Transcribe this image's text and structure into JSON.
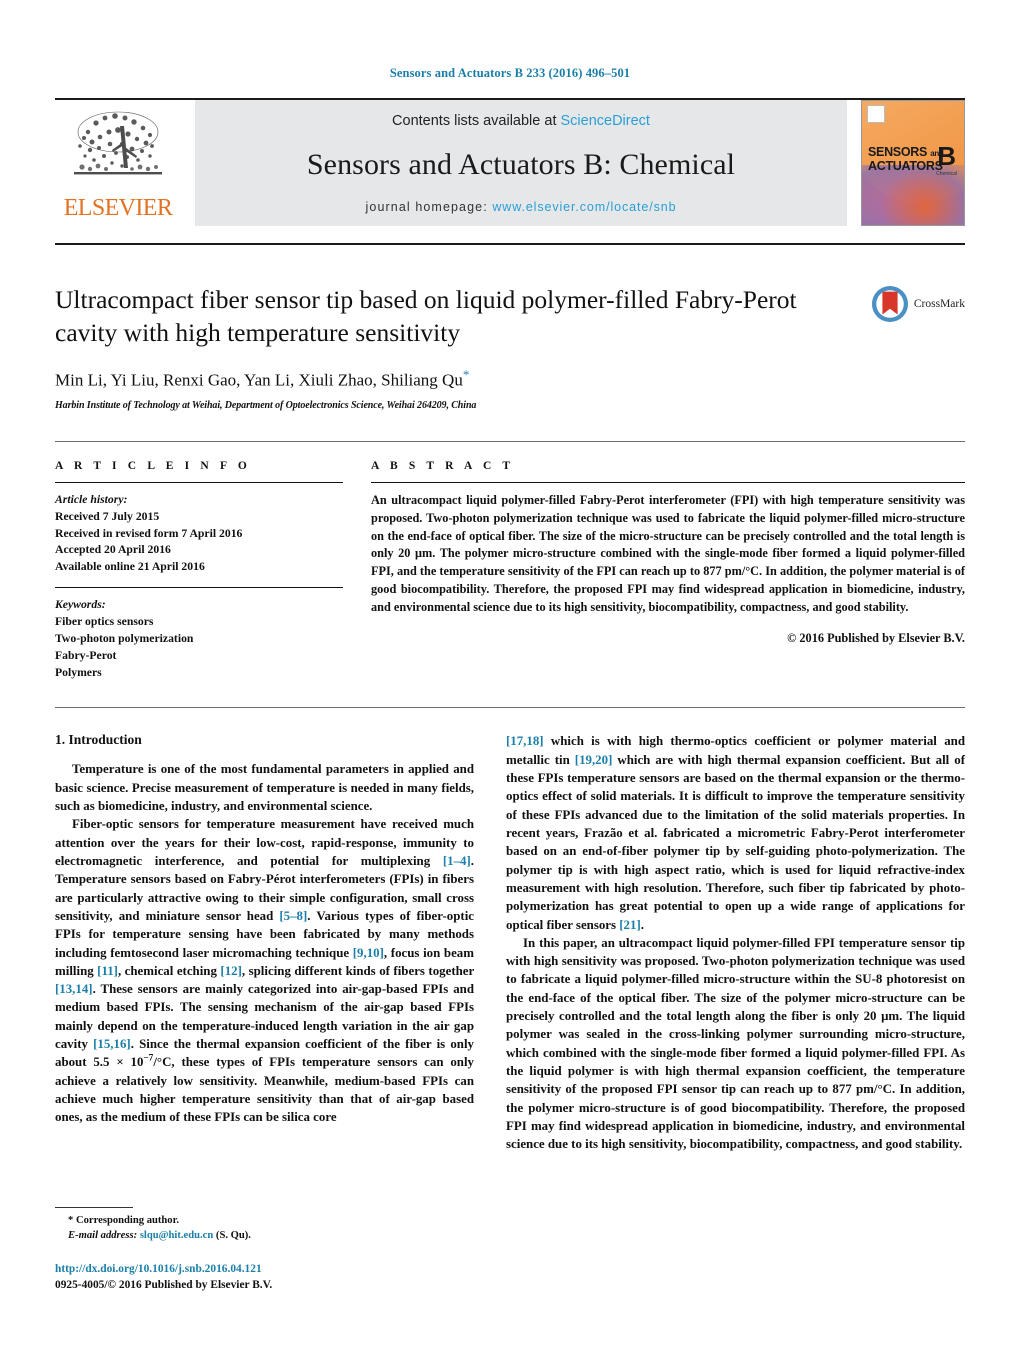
{
  "running_head": "Sensors and Actuators B 233 (2016) 496–501",
  "masthead": {
    "contents_prefix": "Contents lists available at ",
    "sciencedirect": "ScienceDirect",
    "journal_title": "Sensors and Actuators B: Chemical",
    "homepage_prefix": "journal homepage: ",
    "homepage_url": "www.elsevier.com/locate/snb",
    "publisher_logo_text": "ELSEVIER",
    "publisher_logo_icon": "elsevier-tree-icon",
    "cover_line1": "SENSORS",
    "cover_and": "and",
    "cover_line2": "ACTUATORS",
    "cover_letter": "B",
    "cover_sub": "Chemical",
    "link_color": "#2a9fd6",
    "band_color": "#e6e7e8",
    "elsevier_orange": "#E37222"
  },
  "title_block": {
    "title": "Ultracompact fiber sensor tip based on liquid polymer-filled Fabry-Perot cavity with high temperature sensitivity",
    "authors": "Min Li, Yi Liu, Renxi Gao, Yan Li, Xiuli Zhao, Shiliang Qu",
    "corresponding_marker": "*",
    "affiliation": "Harbin Institute of Technology at Weihai, Department of Optoelectronics Science, Weihai 264209, China",
    "crossmark_label": "CrossMark",
    "crossmark_icon": "crossmark-icon"
  },
  "article_info": {
    "heading": "A R T I C L E   I N F O",
    "history_label": "Article history:",
    "history": [
      "Received 7 July 2015",
      "Received in revised form 7 April 2016",
      "Accepted 20 April 2016",
      "Available online 21 April 2016"
    ],
    "keywords_label": "Keywords:",
    "keywords": [
      "Fiber optics sensors",
      "Two-photon polymerization",
      "Fabry-Perot",
      "Polymers"
    ]
  },
  "abstract": {
    "heading": "A B S T R A C T",
    "text": "An ultracompact liquid polymer-filled Fabry-Perot interferometer (FPI) with high temperature sensitivity was proposed. Two-photon polymerization technique was used to fabricate the liquid polymer-filled micro-structure on the end-face of optical fiber. The size of the micro-structure can be precisely controlled and the total length is only 20 μm. The polymer micro-structure combined with the single-mode fiber formed a liquid polymer-filled FPI, and the temperature sensitivity of the FPI can reach up to 877 pm/°C. In addition, the polymer material is of good biocompatibility. Therefore, the proposed FPI may find widespread application in biomedicine, industry, and environmental science due to its high sensitivity, biocompatibility, compactness, and good stability.",
    "copyright": "© 2016 Published by Elsevier B.V."
  },
  "introduction": {
    "section_title": "1.  Introduction",
    "left_paragraphs": [
      "Temperature is one of the most fundamental parameters in applied and basic science. Precise measurement of temperature is needed in many fields, such as biomedicine, industry, and environmental science.",
      "Fiber-optic sensors for temperature measurement have received much attention over the years for their low-cost, rapid-response, immunity to electromagnetic interference, and potential for multiplexing [1–4]. Temperature sensors based on Fabry-Pérot interferometers (FPIs) in fibers are particularly attractive owing to their simple configuration, small cross sensitivity, and miniature sensor head [5–8]. Various types of fiber-optic FPIs for temperature sensing have been fabricated by many methods including femtosecond laser micromaching technique [9,10], focus ion beam milling [11], chemical etching [12], splicing different kinds of fibers together [13,14]. These sensors are mainly categorized into air-gap-based FPIs and medium based FPIs. The sensing mechanism of the air-gap based FPIs mainly depend on the temperature-induced length variation in the air gap cavity [15,16]. Since the thermal expansion coefficient of the fiber is only about 5.5 × 10−7/°C, these types of FPIs temperature sensors can only achieve a relatively low sensitivity. Meanwhile, medium-based FPIs can achieve much higher temperature sensitivity than that of air-gap based ones, as the medium of these FPIs can be silica core"
    ],
    "right_paragraphs": [
      "[17,18] which is with high thermo-optics coefficient or polymer material and metallic tin [19,20] which are with high thermal expansion coefficient. But all of these FPIs temperature sensors are based on the thermal expansion or the thermo-optics effect of solid materials. It is difficult to improve the temperature sensitivity of these FPIs advanced due to the limitation of the solid materials properties. In recent years, Frazão et al. fabricated a micrometric Fabry-Perot interferometer based on an end-of-fiber polymer tip by self-guiding photo-polymerization. The polymer tip is with high aspect ratio, which is used for liquid refractive-index measurement with high resolution. Therefore, such fiber tip fabricated by photo-polymerization has great potential to open up a wide range of applications for optical fiber sensors [21].",
      "In this paper, an ultracompact liquid polymer-filled FPI temperature sensor tip with high sensitivity was proposed. Two-photon polymerization technique was used to fabricate a liquid polymer-filled micro-structure within the SU-8 photoresist on the end-face of the optical fiber. The size of the polymer micro-structure can be precisely controlled and the total length along the fiber is only 20 μm. The liquid polymer was sealed in the cross-linking polymer surrounding micro-structure, which combined with the single-mode fiber formed a liquid polymer-filled FPI. As the liquid polymer is with high thermal expansion coefficient, the temperature sensitivity of the proposed FPI sensor tip can reach up to 877 pm/°C. In addition, the polymer micro-structure is of good biocompatibility. Therefore, the proposed FPI may find widespread application in biomedicine, industry, and environmental science due to its high sensitivity, biocompatibility, compactness, and good stability."
    ]
  },
  "footnote": {
    "corresponding_marker": "*",
    "corresponding_label": "Corresponding author.",
    "email_label": "E-mail address:",
    "email": "slqu@hit.edu.cn",
    "email_suffix": "(S. Qu).",
    "doi_url": "http://dx.doi.org/10.1016/j.snb.2016.04.121",
    "issn_line": "0925-4005/© 2016 Published by Elsevier B.V."
  }
}
